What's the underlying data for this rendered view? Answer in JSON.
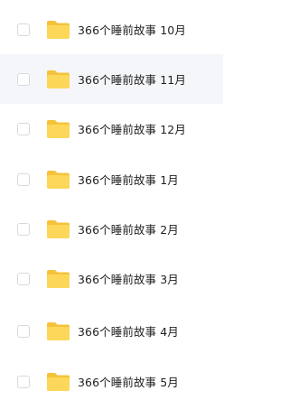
{
  "folder_icon": {
    "name": "folder-icon",
    "color_back": "#f5c33b",
    "color_front": "#fdd75a"
  },
  "items": [
    {
      "label": "366个睡前故事 10月",
      "hover": false
    },
    {
      "label": "366个睡前故事 11月",
      "hover": true
    },
    {
      "label": "366个睡前故事 12月",
      "hover": false
    },
    {
      "label": "366个睡前故事 1月",
      "hover": false
    },
    {
      "label": "366个睡前故事 2月",
      "hover": false
    },
    {
      "label": "366个睡前故事 3月",
      "hover": false
    },
    {
      "label": "366个睡前故事 4月",
      "hover": false
    },
    {
      "label": "366个睡前故事 5月",
      "hover": false
    }
  ]
}
